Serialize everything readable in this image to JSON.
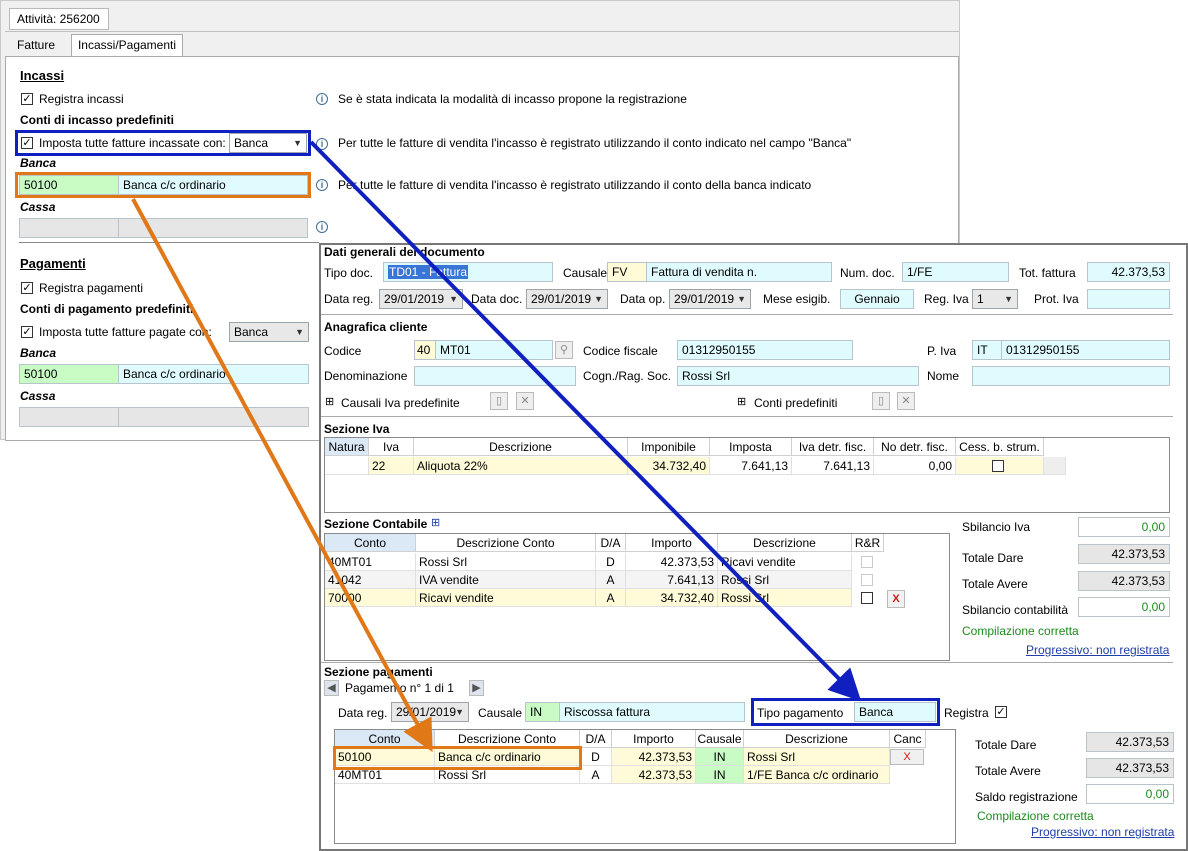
{
  "window": {
    "title": "Attività: 256200"
  },
  "tabs": [
    {
      "label": "Fatture"
    },
    {
      "label": "Incassi/Pagamenti"
    }
  ],
  "incassi": {
    "heading": "Incassi",
    "registra_label": "Registra incassi",
    "registra_info": "Se è stata indicata la modalità di incasso propone la registrazione",
    "conti_heading": "Conti di incasso predefiniti",
    "imposta_label": "Imposta tutte fatture incassate con:",
    "imposta_value": "Banca",
    "imposta_info": "Per tutte le fatture di vendita l'incasso è registrato utilizzando il conto indicato nel campo \"Banca\"",
    "banca_label": "Banca",
    "banca_code": "50100",
    "banca_desc": "Banca c/c ordinario",
    "banca_info": "Per tutte le fatture di vendita l'incasso è registrato utilizzando il conto della banca indicato",
    "cassa_label": "Cassa"
  },
  "pagamenti": {
    "heading": "Pagamenti",
    "registra_label": "Registra pagamenti",
    "conti_heading": "Conti di pagamento predefiniti",
    "imposta_label": "Imposta tutte fatture pagate con:",
    "imposta_value": "Banca",
    "banca_label": "Banca",
    "banca_code": "50100",
    "banca_desc": "Banca c/c ordinario",
    "cassa_label": "Cassa"
  },
  "doc": {
    "heading": "Dati generali del documento",
    "tipo_doc_label": "Tipo doc.",
    "tipo_doc_value": "TD01 - Fattura",
    "causale_label": "Causale",
    "causale_code": "FV",
    "causale_desc": "Fattura di vendita n.",
    "num_doc_label": "Num. doc.",
    "num_doc_value": "1/FE",
    "tot_fattura_label": "Tot. fattura",
    "tot_fattura_value": "42.373,53",
    "data_reg_label": "Data reg.",
    "data_reg_value": "29/01/2019",
    "data_doc_label": "Data doc.",
    "data_doc_value": "29/01/2019",
    "data_op_label": "Data op.",
    "data_op_value": "29/01/2019",
    "mese_label": "Mese esigib.",
    "mese_value": "Gennaio",
    "reg_iva_label": "Reg. Iva",
    "reg_iva_value": "1",
    "prot_iva_label": "Prot. Iva",
    "prot_iva_value": ""
  },
  "cliente": {
    "heading": "Anagrafica cliente",
    "codice_label": "Codice",
    "codice_num": "40",
    "codice_value": "MT01",
    "cf_label": "Codice fiscale",
    "cf_value": "01312950155",
    "piva_label": "P. Iva",
    "piva_country": "IT",
    "piva_value": "01312950155",
    "denominazione_label": "Denominazione",
    "denominazione_value": "",
    "cognome_label": "Cogn./Rag. Soc.",
    "cognome_value": "Rossi Srl",
    "nome_label": "Nome",
    "nome_value": "",
    "causali_label": "Causali Iva predefinite",
    "conti_label": "Conti predefiniti"
  },
  "iva": {
    "heading": "Sezione Iva",
    "columns": [
      "Natura",
      "Iva",
      "Descrizione",
      "Imponibile",
      "Imposta",
      "Iva detr. fisc.",
      "No detr. fisc.",
      "Cess. b. strum."
    ],
    "rows": [
      [
        "",
        "22",
        "Aliquota 22%",
        "34.732,40",
        "7.641,13",
        "7.641,13",
        "0,00",
        ""
      ]
    ]
  },
  "contabile": {
    "heading": "Sezione Contabile",
    "columns": [
      "Conto",
      "Descrizione Conto",
      "D/A",
      "Importo",
      "Descrizione",
      "R&R"
    ],
    "rows": [
      [
        "40MT01",
        "Rossi Srl",
        "D",
        "42.373,53",
        "Ricavi vendite"
      ],
      [
        "41042",
        "IVA vendite",
        "A",
        "7.641,13",
        "Rossi Srl"
      ],
      [
        "70000",
        "Ricavi vendite",
        "A",
        "34.732,40",
        "Rossi Srl"
      ]
    ]
  },
  "totali_contabile": {
    "sbilancio_iva_label": "Sbilancio Iva",
    "sbilancio_iva_value": "0,00",
    "totale_dare_label": "Totale Dare",
    "totale_dare_value": "42.373,53",
    "totale_avere_label": "Totale Avere",
    "totale_avere_value": "42.373,53",
    "sbilancio_cont_label": "Sbilancio contabilità",
    "sbilancio_cont_value": "0,00",
    "status": "Compilazione corretta",
    "progressivo": "Progressivo: non registrata"
  },
  "sez_pagamenti": {
    "heading": "Sezione pagamenti",
    "nav_label": "Pagamento n° 1 di 1",
    "data_reg_label": "Data reg.",
    "data_reg_value": "29/01/2019",
    "causale_label": "Causale",
    "causale_code": "IN",
    "causale_desc": "Riscossa fattura",
    "tipo_label": "Tipo pagamento",
    "tipo_value": "Banca",
    "registra_label": "Registra",
    "columns": [
      "Conto",
      "Descrizione Conto",
      "D/A",
      "Importo",
      "Causale",
      "Descrizione",
      "Canc"
    ],
    "rows": [
      [
        "50100",
        "Banca c/c ordinario",
        "D",
        "42.373,53",
        "IN",
        "Rossi Srl"
      ],
      [
        "40MT01",
        "Rossi Srl",
        "A",
        "42.373,53",
        "IN",
        "1/FE Banca c/c ordinario"
      ]
    ],
    "totale_dare_label": "Totale Dare",
    "totale_dare_value": "42.373,53",
    "totale_avere_label": "Totale Avere",
    "totale_avere_value": "42.373,53",
    "saldo_label": "Saldo registrazione",
    "saldo_value": "0,00",
    "status": "Compilazione corretta",
    "progressivo": "Progressivo: non registrata"
  },
  "colors": {
    "blue_highlight": "#1020c0",
    "orange_highlight": "#e07818",
    "cyan_field": "#e0fbfd",
    "green_field": "#c8fcc4",
    "yellow_field": "#fffbd8"
  }
}
